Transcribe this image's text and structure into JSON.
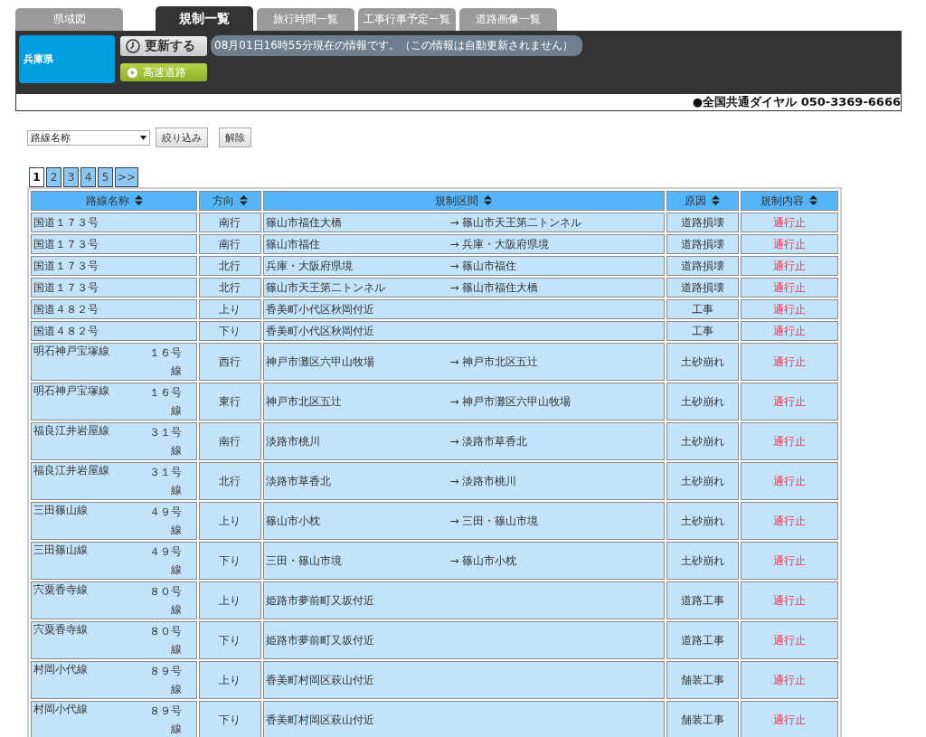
{
  "tabs": [
    {
      "label": "県域図",
      "selected": false
    },
    {
      "label": "規制一覧",
      "selected": true
    },
    {
      "label": "旅行時間一覧",
      "selected": false
    },
    {
      "label": "工事行事予定一覧",
      "selected": false
    },
    {
      "label": "道路画像一覧",
      "selected": false
    }
  ],
  "prefecture": "兵庫県",
  "refresh_button": "更新する",
  "info_message": "08月01日16時55分現在の情報です。（この情報は自動更新されません）",
  "expressway_button": "高速道路",
  "hotline": "●全国共通ダイヤル 050-3369-6666",
  "filter": {
    "select_value": "路線名称",
    "apply_button": "絞り込み",
    "clear_button": "解除"
  },
  "pages": [
    {
      "label": "1",
      "selected": true
    },
    {
      "label": "2",
      "selected": false
    },
    {
      "label": "3",
      "selected": false
    },
    {
      "label": "4",
      "selected": false
    },
    {
      "label": "5",
      "selected": false
    },
    {
      "label": ">>",
      "selected": false
    }
  ],
  "table": {
    "columns": [
      "路線名称",
      "方向",
      "規制区間",
      "原因",
      "規制内容"
    ],
    "rows": [
      {
        "route": "国道１７３号",
        "direction": "南行",
        "from": "篠山市福住大橋",
        "to": "→ 篠山市天王第二トンネル",
        "cause": "道路損壊",
        "regulation": "通行止"
      },
      {
        "route": "国道１７３号",
        "direction": "南行",
        "from": "篠山市福住",
        "to": "→ 兵庫・大阪府県境",
        "cause": "道路損壊",
        "regulation": "通行止"
      },
      {
        "route": "国道１７３号",
        "direction": "北行",
        "from": "兵庫・大阪府県境",
        "to": "→ 篠山市福住",
        "cause": "道路損壊",
        "regulation": "通行止"
      },
      {
        "route": "国道１７３号",
        "direction": "北行",
        "from": "篠山市天王第二トンネル",
        "to": "→ 篠山市福住大橋",
        "cause": "道路損壊",
        "regulation": "通行止"
      },
      {
        "route": "国道４８２号",
        "direction": "上り",
        "from": "香美町小代区秋岡付近",
        "cause": "工事",
        "regulation": "通行止"
      },
      {
        "route": "国道４８２号",
        "direction": "下り",
        "from": "香美町小代区秋岡付近",
        "cause": "工事",
        "regulation": "通行止"
      },
      {
        "route": "明石神戸宝塚線",
        "route_no": "１６号線",
        "direction": "西行",
        "from": "神戸市灘区六甲山牧場",
        "to": "→ 神戸市北区五辻",
        "cause": "土砂崩れ",
        "regulation": "通行止"
      },
      {
        "route": "明石神戸宝塚線",
        "route_no": "１６号線",
        "direction": "東行",
        "from": "神戸市北区五辻",
        "to": "→ 神戸市灘区六甲山牧場",
        "cause": "土砂崩れ",
        "regulation": "通行止"
      },
      {
        "route": "福良江井岩屋線",
        "route_no": "３１号線",
        "direction": "南行",
        "from": "淡路市桃川",
        "to": "→ 淡路市草香北",
        "cause": "土砂崩れ",
        "regulation": "通行止"
      },
      {
        "route": "福良江井岩屋線",
        "route_no": "３１号線",
        "direction": "北行",
        "from": "淡路市草香北",
        "to": "→ 淡路市桃川",
        "cause": "土砂崩れ",
        "regulation": "通行止"
      },
      {
        "route": "三田篠山線",
        "route_no": "４９号線",
        "direction": "上り",
        "from": "篠山市小枕",
        "to": "→ 三田・篠山市境",
        "cause": "土砂崩れ",
        "regulation": "通行止"
      },
      {
        "route": "三田篠山線",
        "route_no": "４９号線",
        "direction": "下り",
        "from": "三田・篠山市境",
        "to": "→ 篠山市小枕",
        "cause": "土砂崩れ",
        "regulation": "通行止"
      },
      {
        "route": "宍粟香寺線",
        "route_no": "８０号線",
        "direction": "上り",
        "from": "姫路市夢前町又坂付近",
        "cause": "道路工事",
        "regulation": "通行止"
      },
      {
        "route": "宍粟香寺線",
        "route_no": "８０号線",
        "direction": "下り",
        "from": "姫路市夢前町又坂付近",
        "cause": "道路工事",
        "regulation": "通行止"
      },
      {
        "route": "村岡小代線",
        "route_no": "８９号線",
        "direction": "上り",
        "from": "香美町村岡区萩山付近",
        "cause": "舗装工事",
        "regulation": "通行止"
      },
      {
        "route": "村岡小代線",
        "route_no": "８９号線",
        "direction": "下り",
        "from": "香美町村岡区萩山付近",
        "cause": "舗装工事",
        "regulation": "通行止"
      }
    ]
  }
}
